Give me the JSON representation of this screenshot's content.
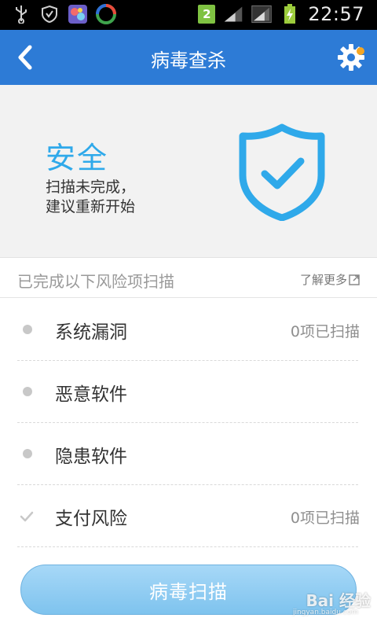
{
  "status_bar": {
    "sim_slot": "2",
    "time": "22:57"
  },
  "header": {
    "title": "病毒查杀"
  },
  "status_panel": {
    "state": "安全",
    "message_line1": "扫描未完成，",
    "message_line2": "建议重新开始"
  },
  "section": {
    "title": "已完成以下风险项扫描",
    "learn_more": "了解更多"
  },
  "scan_items": [
    {
      "label": "系统漏洞",
      "status": "0项已扫描",
      "marker": "dot"
    },
    {
      "label": "恶意软件",
      "status": "",
      "marker": "dot"
    },
    {
      "label": "隐患软件",
      "status": "",
      "marker": "dot"
    },
    {
      "label": "支付风险",
      "status": "0项已扫描",
      "marker": "check"
    }
  ],
  "scan_button": {
    "label": "病毒扫描"
  },
  "watermark": {
    "text": "Bai 经验",
    "sub": "jingyan.baidu.com"
  },
  "colors": {
    "title_bar": "#2d7bd6",
    "accent": "#2fa9ea",
    "notify_dot": "#f5a623"
  }
}
